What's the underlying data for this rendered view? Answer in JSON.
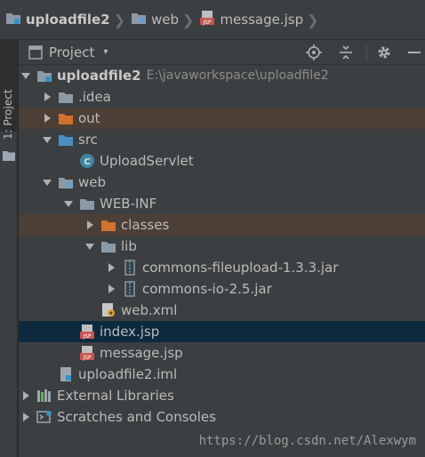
{
  "breadcrumb": {
    "items": [
      {
        "label": "uploadfile2",
        "icon": "module-folder-icon"
      },
      {
        "label": "web",
        "icon": "web-folder-icon"
      },
      {
        "label": "message.jsp",
        "icon": "jsp-file-icon"
      }
    ]
  },
  "side_strip": {
    "tab_label": "1: Project"
  },
  "project_toolbar": {
    "title": "Project",
    "caret": "▾",
    "icons": [
      "locate-icon",
      "collapse-all-icon",
      "settings-icon",
      "hide-icon"
    ]
  },
  "tree": {
    "rows": [
      {
        "label": "uploadfile2",
        "path": "E:\\javaworkspace\\uploadfile2",
        "icon": "module-folder-icon"
      },
      {
        "label": ".idea",
        "icon": "folder-icon"
      },
      {
        "label": "out",
        "icon": "excluded-folder-icon"
      },
      {
        "label": "src",
        "icon": "source-folder-icon"
      },
      {
        "label": "UploadServlet",
        "icon": "class-icon"
      },
      {
        "label": "web",
        "icon": "web-folder-icon"
      },
      {
        "label": "WEB-INF",
        "icon": "folder-icon"
      },
      {
        "label": "classes",
        "icon": "excluded-folder-icon"
      },
      {
        "label": "lib",
        "icon": "folder-icon"
      },
      {
        "label": "commons-fileupload-1.3.3.jar",
        "icon": "jar-icon"
      },
      {
        "label": "commons-io-2.5.jar",
        "icon": "jar-icon"
      },
      {
        "label": "web.xml",
        "icon": "xml-file-icon"
      },
      {
        "label": "index.jsp",
        "icon": "jsp-file-icon"
      },
      {
        "label": "message.jsp",
        "icon": "jsp-file-icon"
      },
      {
        "label": "uploadfile2.iml",
        "icon": "iml-file-icon"
      },
      {
        "label": "External Libraries",
        "icon": "libraries-icon"
      },
      {
        "label": "Scratches and Consoles",
        "icon": "scratches-icon"
      }
    ]
  },
  "colors": {
    "panel_bg": "#3c3f41",
    "selection": "#0d293e",
    "excluded_highlight": "#4c3f36",
    "text": "#bbbbbb"
  },
  "watermark": "https://blog.csdn.net/Alexwym"
}
